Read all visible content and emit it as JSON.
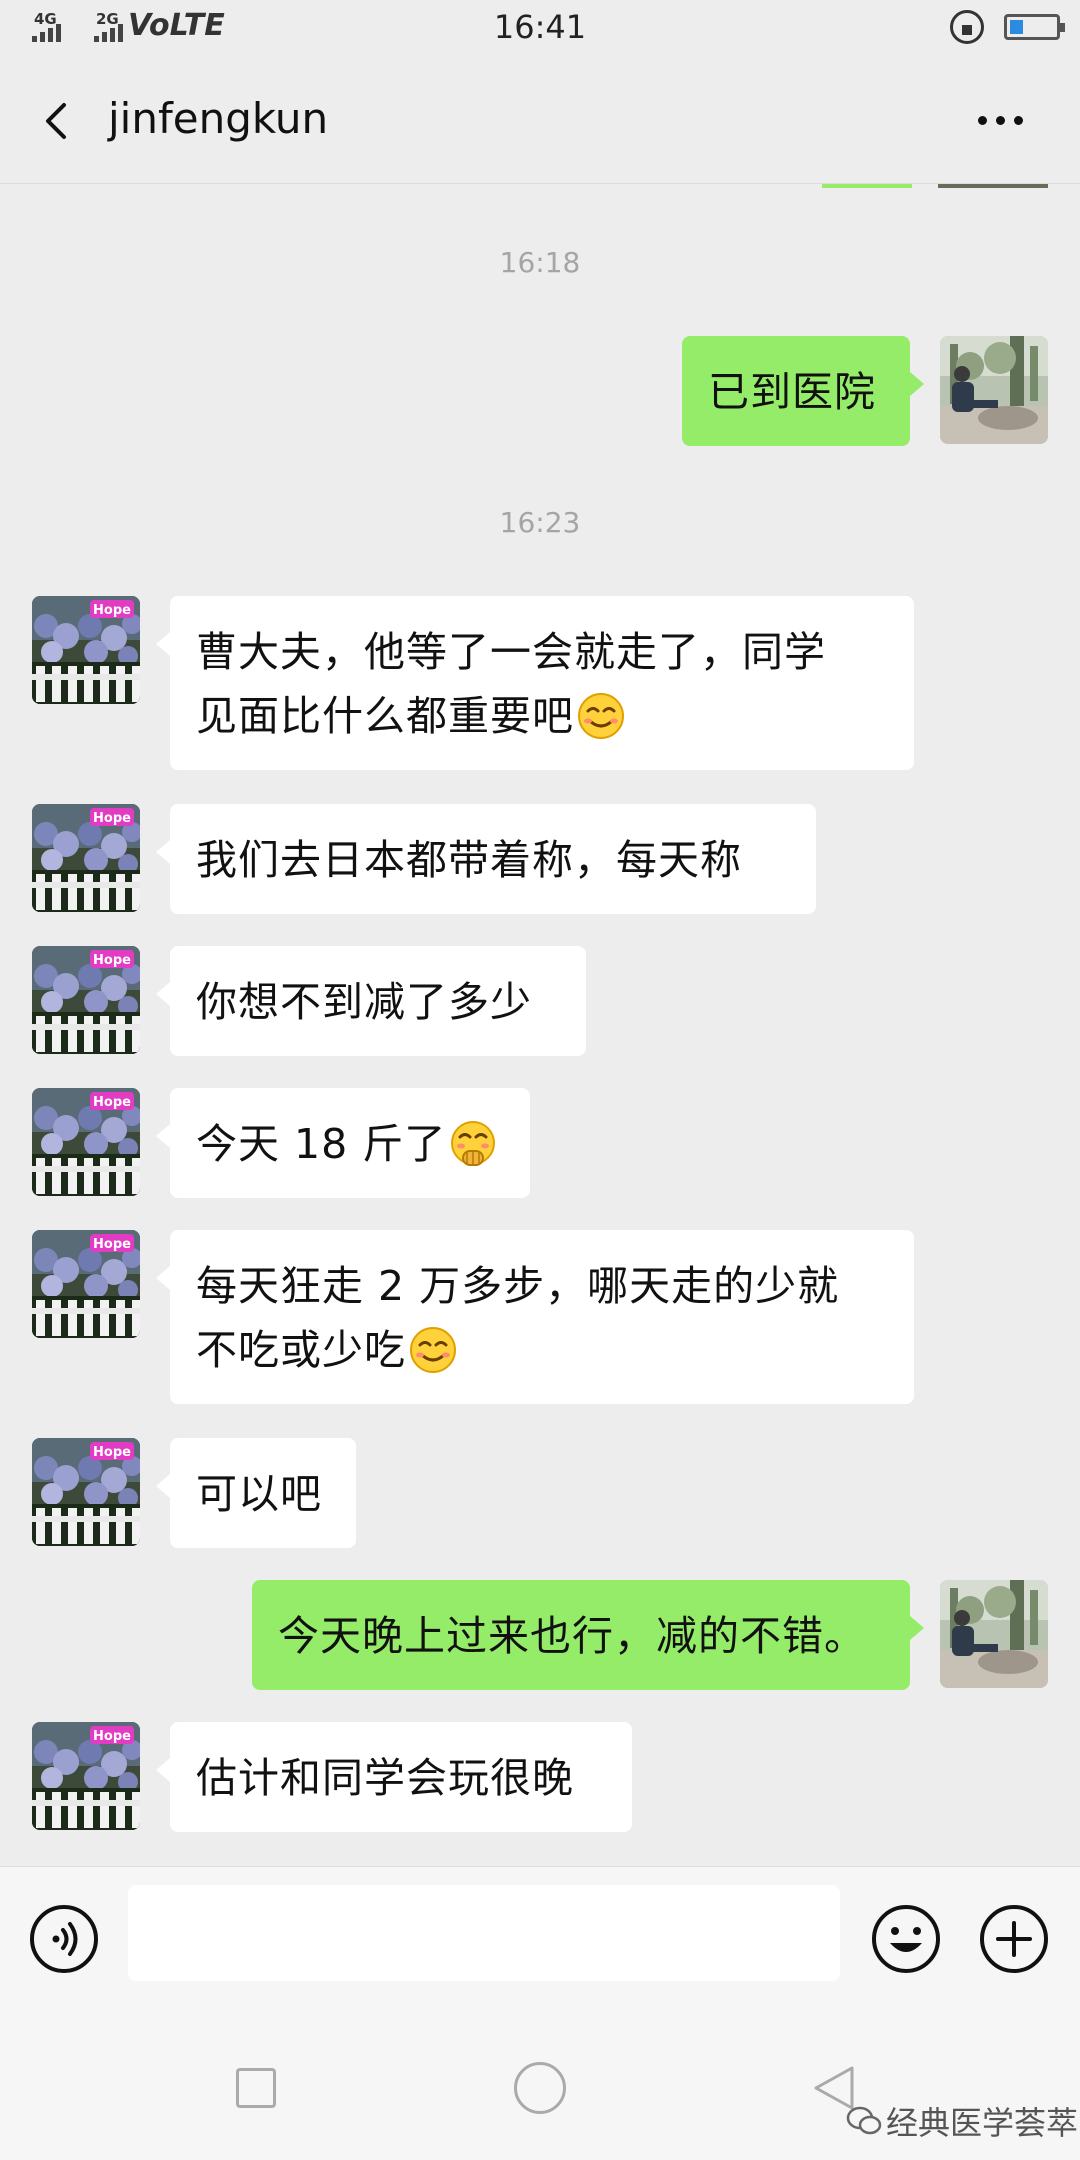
{
  "status_bar": {
    "signal1": "4G",
    "signal2": "2G",
    "network": "VoLTE",
    "time": "16:41",
    "battery_level": 0.3,
    "battery_color": "#2b8be0"
  },
  "header": {
    "title": "jinfengkun",
    "back_icon": "chevron-left-icon",
    "more_icon": "more-dots-icon"
  },
  "colors": {
    "background": "#ededed",
    "my_bubble": "#95ec69",
    "their_bubble": "#ffffff",
    "timestamp_text": "#a5a5a5"
  },
  "messages": {
    "t1": "16:18",
    "m1": "已到医院",
    "t2": "16:23",
    "m2a": "曹大夫，他等了一会就走了，同学",
    "m2b": "见面比什么都重要吧",
    "m3": "我们去日本都带着称，每天称",
    "m4": "你想不到减了多少",
    "m5": "今天 18 斤了",
    "m6a": "每天狂走 2 万多步，哪天走的少就",
    "m6b": "不吃或少吃",
    "m7": "可以吧",
    "m8": "今天晚上过来也行，减的不错。",
    "m9": "估计和同学会玩很晚"
  },
  "input_bar": {
    "voice_icon": "voice-icon",
    "input_value": "",
    "emoji_icon": "emoji-icon",
    "plus_icon": "plus-icon"
  },
  "nav": {
    "recent_icon": "square-icon",
    "home_icon": "circle-icon",
    "back_icon": "triangle-back-icon"
  },
  "watermark": "经典医学荟萃"
}
